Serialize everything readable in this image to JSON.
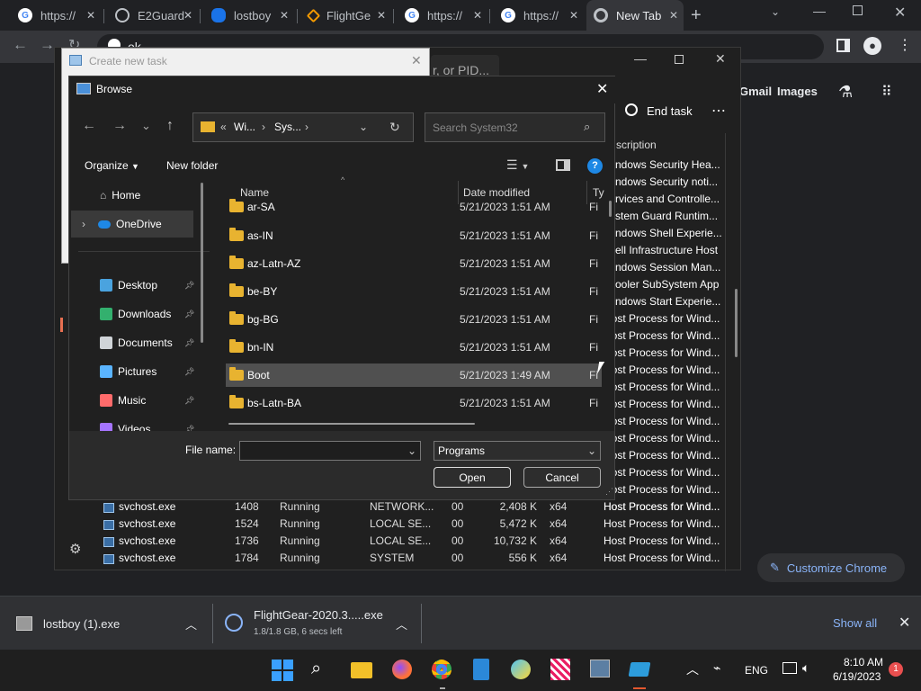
{
  "tabs": [
    {
      "label": "https://",
      "icon": "google-icon"
    },
    {
      "label": "E2Guard",
      "icon": "globe-icon"
    },
    {
      "label": "lostboy",
      "icon": "fish-icon"
    },
    {
      "label": "FlightGe",
      "icon": "flightgear-icon"
    },
    {
      "label": "https://",
      "icon": "google-icon"
    },
    {
      "label": "https://",
      "icon": "google-icon"
    },
    {
      "label": "New Tab",
      "icon": "chrome-icon"
    }
  ],
  "omnibox": {
    "text": "ok"
  },
  "google_links": {
    "gmail": "Gmail",
    "images": "Images"
  },
  "customize_chrome": "Customize Chrome",
  "taskmgr": {
    "search_placeholder": "r, or PID...",
    "end_task": "End task",
    "description_header": "scription",
    "descriptions": [
      "ndows Security Hea...",
      "ndows Security noti...",
      "rvices and Controlle...",
      "stem Guard Runtim...",
      "ndows Shell Experie...",
      "ell Infrastructure Host",
      "ndows Session Man...",
      "ooler SubSystem App",
      "ndows Start Experie...",
      "Host Process for Wind...",
      "Host Process for Wind...",
      "Host Process for Wind...",
      "Host Process for Wind...",
      "Host Process for Wind...",
      "Host Process for Wind...",
      "Host Process for Wind...",
      "Host Process for Wind...",
      "Host Process for Wind...",
      "Host Process for Wind...",
      "Host Process for Wind...",
      "Host Process for Wind..."
    ],
    "rows": [
      {
        "name": "svchost.exe",
        "pid": "1408",
        "status": "Running",
        "user": "NETWORK...",
        "cpu": "00",
        "mem": "2,408 K",
        "arch": "x64",
        "desc": "Host Process for Wind..."
      },
      {
        "name": "svchost.exe",
        "pid": "1524",
        "status": "Running",
        "user": "LOCAL SE...",
        "cpu": "00",
        "mem": "5,472 K",
        "arch": "x64",
        "desc": "Host Process for Wind..."
      },
      {
        "name": "svchost.exe",
        "pid": "1736",
        "status": "Running",
        "user": "LOCAL SE...",
        "cpu": "00",
        "mem": "10,732 K",
        "arch": "x64",
        "desc": "Host Process for Wind..."
      },
      {
        "name": "svchost.exe",
        "pid": "1784",
        "status": "Running",
        "user": "SYSTEM",
        "cpu": "00",
        "mem": "556 K",
        "arch": "x64",
        "desc": "Host Process for Wind..."
      }
    ]
  },
  "createtask": {
    "title": "Create new task"
  },
  "browse": {
    "title": "Browse",
    "breadcrumb": [
      "«",
      "Wi...",
      "Sys..."
    ],
    "search_placeholder": "Search System32",
    "organize": "Organize",
    "new_folder": "New folder",
    "columns": {
      "name": "Name",
      "date": "Date modified",
      "type": "Ty"
    },
    "nav": [
      {
        "label": "Home",
        "icon": "home-icon"
      },
      {
        "label": "OneDrive",
        "icon": "onedrive-icon"
      },
      {
        "label": "Desktop",
        "icon": "desktop-icon"
      },
      {
        "label": "Downloads",
        "icon": "downloads-icon"
      },
      {
        "label": "Documents",
        "icon": "documents-icon"
      },
      {
        "label": "Pictures",
        "icon": "pictures-icon"
      },
      {
        "label": "Music",
        "icon": "music-icon"
      },
      {
        "label": "Videos",
        "icon": "videos-icon"
      }
    ],
    "files": [
      {
        "name": "ar-SA",
        "date": "5/21/2023 1:51 AM",
        "type": "Fi"
      },
      {
        "name": "as-IN",
        "date": "5/21/2023 1:51 AM",
        "type": "Fi"
      },
      {
        "name": "az-Latn-AZ",
        "date": "5/21/2023 1:51 AM",
        "type": "Fi"
      },
      {
        "name": "be-BY",
        "date": "5/21/2023 1:51 AM",
        "type": "Fi"
      },
      {
        "name": "bg-BG",
        "date": "5/21/2023 1:51 AM",
        "type": "Fi"
      },
      {
        "name": "bn-IN",
        "date": "5/21/2023 1:51 AM",
        "type": "Fi"
      },
      {
        "name": "Boot",
        "date": "5/21/2023 1:49 AM",
        "type": "Fi"
      },
      {
        "name": "bs-Latn-BA",
        "date": "5/21/2023 1:51 AM",
        "type": "Fi"
      }
    ],
    "file_name_label": "File name:",
    "file_name_value": "",
    "file_type": "Programs",
    "open": "Open",
    "cancel": "Cancel"
  },
  "downloads": [
    {
      "name": "lostboy (1).exe",
      "status": ""
    },
    {
      "name": "FlightGear-2020.3.....exe",
      "status": "1.8/1.8 GB, 6 secs left"
    }
  ],
  "show_all": "Show all",
  "tray": {
    "lang": "ENG",
    "time": "8:10 AM",
    "date": "6/19/2023",
    "badge": "1"
  }
}
